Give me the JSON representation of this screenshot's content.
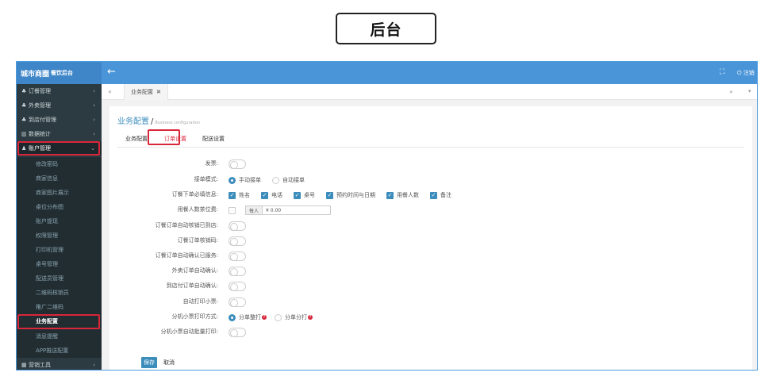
{
  "caption": "后台",
  "topbar": {
    "brand": "城市商圈",
    "brand_sub": "餐饮后台",
    "back_icon": "arrow-left-icon",
    "fullscreen_icon": "expand-icon",
    "logout_label": "注销"
  },
  "sidebar": {
    "items": [
      {
        "label": "订餐管理"
      },
      {
        "label": "外卖管理"
      },
      {
        "label": "到店付管理"
      },
      {
        "label": "数据统计"
      },
      {
        "label": "账户管理"
      }
    ],
    "sub_items": [
      {
        "label": "修改密码"
      },
      {
        "label": "商家信息"
      },
      {
        "label": "商家图片展示"
      },
      {
        "label": "桌位分布图"
      },
      {
        "label": "账户提现"
      },
      {
        "label": "权限管理"
      },
      {
        "label": "打印机管理"
      },
      {
        "label": "桌号管理"
      },
      {
        "label": "配送员管理"
      },
      {
        "label": "二维码核销员"
      },
      {
        "label": "推广二维码"
      },
      {
        "label": "业务配置"
      },
      {
        "label": "消息提醒"
      },
      {
        "label": "APP推送配置"
      }
    ],
    "bottom_item": {
      "label": "营销工具"
    }
  },
  "tabs": {
    "current": "业务配置"
  },
  "panel": {
    "breadcrumb_title": "业务配置",
    "breadcrumb_en": "Business configuration",
    "subtabs": [
      "业务配置",
      "订单设置",
      "配送设置"
    ],
    "active_subtab": "订单设置"
  },
  "form": {
    "invoice_label": "发票:",
    "mode_label": "接单模式:",
    "mode_options": [
      "手动接单",
      "自动接单"
    ],
    "required_label": "订餐下单必填信息:",
    "required_options": [
      "姓名",
      "电话",
      "桌号",
      "预约时间与日期",
      "用餐人数",
      "备注"
    ],
    "fee_label": "用餐人数茶位费:",
    "fee_prefix": "每人",
    "fee_value": "¥ 0.00",
    "auto_verify_label": "订餐订单自动核销已到店:",
    "verify_code_label": "订餐订单核销码:",
    "auto_confirm_served_label": "订餐订单自动确认已服务:",
    "takeout_confirm_label": "外卖订单自动确认:",
    "storepay_confirm_label": "到店付订单自动确认:",
    "auto_print_label": "自动打印小票:",
    "print_mode_label": "分机小票打印方式:",
    "print_mode_options": [
      "分单整打",
      "分单分打"
    ],
    "batch_print_label": "分机小票自动批量打印:",
    "save_label": "保存",
    "cancel_label": "取消"
  }
}
